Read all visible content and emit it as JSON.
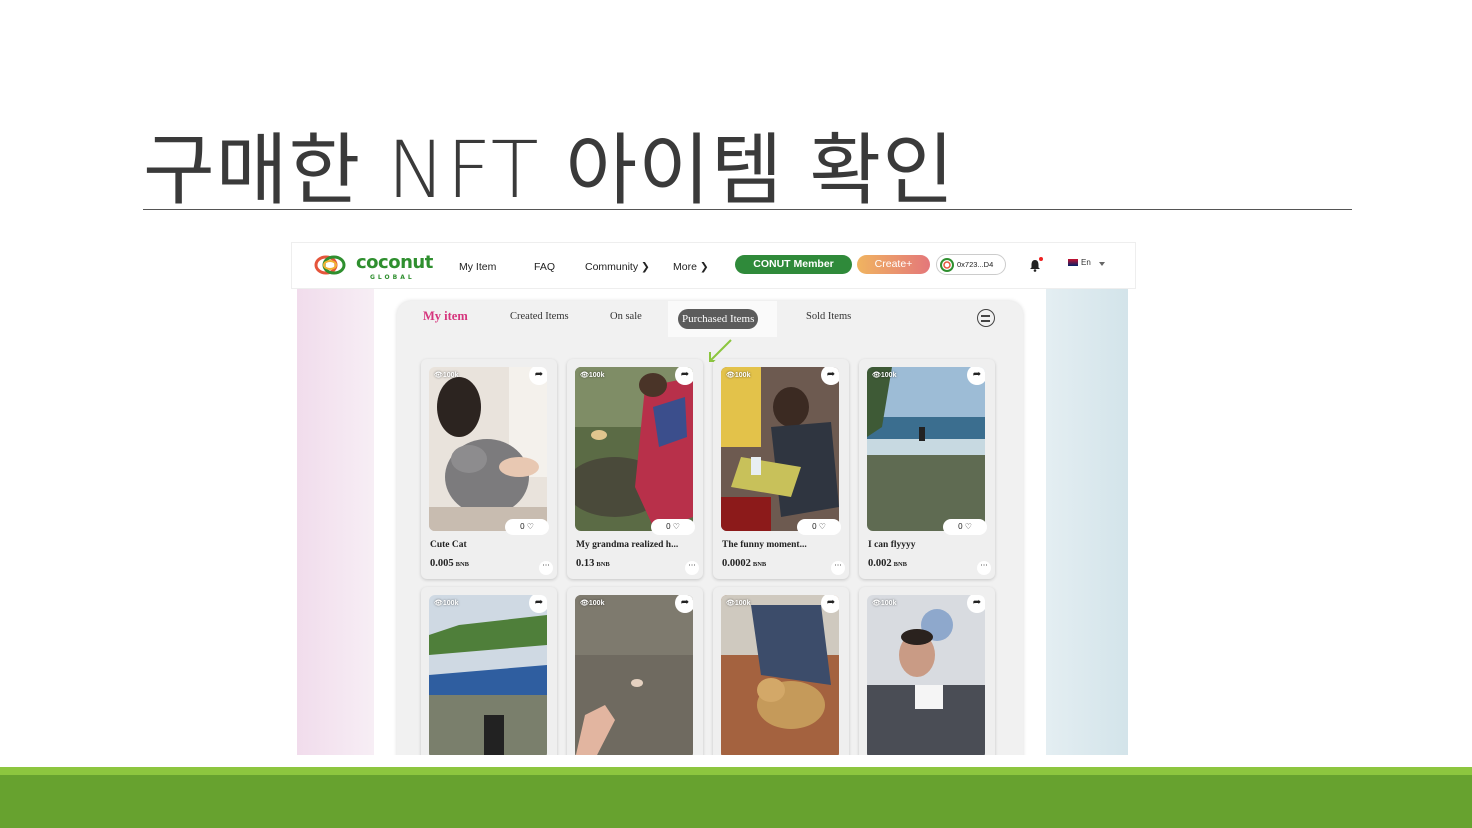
{
  "slide": {
    "title": "구매한 NFT 아이템 확인"
  },
  "navbar": {
    "logo_text": "coconut",
    "logo_sub": "GLOBAL",
    "links": [
      "My Item",
      "FAQ",
      "Community ❯",
      "More ❯"
    ],
    "member_button": "CONUT Member",
    "create_button": "Create+",
    "wallet": "0x723...D4",
    "language": "En"
  },
  "tabs": {
    "my_item": "My item",
    "created": "Created Items",
    "on_sale": "On sale",
    "purchased": "Purchased Items",
    "sold": "Sold Items"
  },
  "cards": [
    {
      "views": "100k",
      "likes": "0",
      "title": "Cute Cat",
      "price": "0.005",
      "unit": "BNB"
    },
    {
      "views": "100k",
      "likes": "0",
      "title": "My grandma realized h...",
      "price": "0.13",
      "unit": "BNB"
    },
    {
      "views": "100k",
      "likes": "0",
      "title": "The funny moment...",
      "price": "0.0002",
      "unit": "BNB"
    },
    {
      "views": "100k",
      "likes": "0",
      "title": "I can flyyyy",
      "price": "0.002",
      "unit": "BNB"
    },
    {
      "views": "100k"
    },
    {
      "views": "100k"
    },
    {
      "views": "100k"
    },
    {
      "views": "100k"
    }
  ],
  "colors": {
    "accent_green": "#2f8a3a",
    "brand_pink": "#d6357d",
    "band_light": "#8dc63f",
    "band_dark": "#67a22f"
  }
}
